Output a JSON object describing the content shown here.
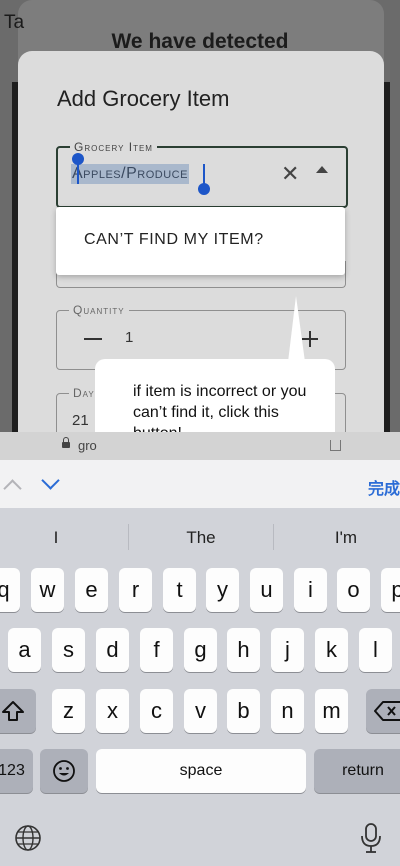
{
  "background": {
    "left_text": "Ta",
    "title": "We have detected"
  },
  "dialog": {
    "title": "Add Grocery Item",
    "grocery_field": {
      "label": "Grocery Item",
      "value": "Apples/Produce"
    },
    "quantity_field": {
      "label": "Quantity",
      "value": "1"
    },
    "days_field": {
      "label": "Day",
      "value": "21"
    }
  },
  "autocomplete": {
    "option": "CAN’T FIND MY ITEM?"
  },
  "tooltip": {
    "text": "if item is incorrect or you can’t find it, click this button!"
  },
  "urlbar": {
    "url_text": "gro"
  },
  "keyboard_toolbar": {
    "done_label": "完成"
  },
  "keyboard": {
    "suggestions": [
      "I",
      "The",
      "I'm"
    ],
    "row1": [
      "q",
      "w",
      "e",
      "r",
      "t",
      "y",
      "u",
      "i",
      "o",
      "p"
    ],
    "row2": [
      "a",
      "s",
      "d",
      "f",
      "g",
      "h",
      "j",
      "k",
      "l"
    ],
    "row3": [
      "z",
      "x",
      "c",
      "v",
      "b",
      "n",
      "m"
    ],
    "numbers_label": "123",
    "space_label": "space",
    "return_label": "return"
  },
  "colors": {
    "accent_blue": "#2b6cd6",
    "selection_handle": "#1d56c8",
    "dialog_bg": "#dcdcdc"
  }
}
